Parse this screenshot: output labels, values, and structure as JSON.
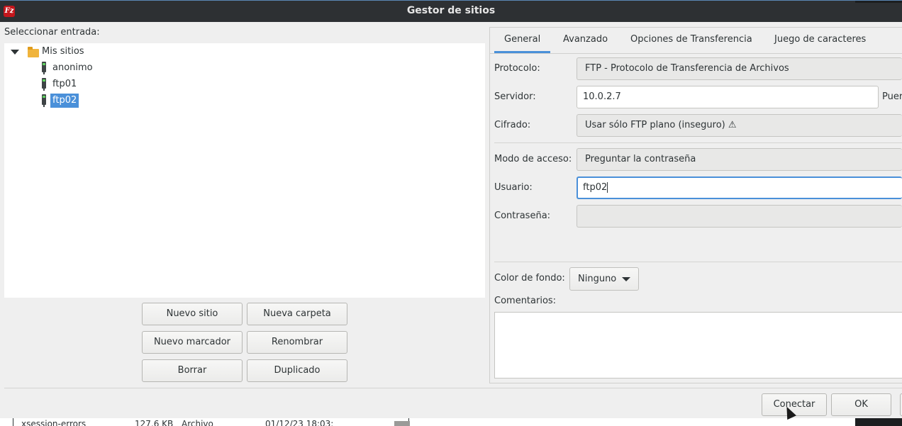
{
  "window": {
    "title": "Gestor de sitios",
    "app_icon_text": "Fz"
  },
  "left": {
    "select_label": "Seleccionar entrada:",
    "tree": {
      "root": "Mis sitios",
      "sites": [
        "anonimo",
        "ftp01",
        "ftp02"
      ],
      "selected": "ftp02"
    },
    "buttons": {
      "new_site": "Nuevo sitio",
      "new_folder": "Nueva carpeta",
      "new_bookmark": "Nuevo marcador",
      "rename": "Renombrar",
      "delete": "Borrar",
      "duplicate": "Duplicado"
    }
  },
  "tabs": [
    "General",
    "Avanzado",
    "Opciones de Transferencia",
    "Juego de caracteres"
  ],
  "active_tab": "General",
  "form": {
    "protocol_label": "Protocolo:",
    "protocol_value": "FTP - Protocolo de Transferencia de Archivos",
    "server_label": "Servidor:",
    "server_value": "10.0.2.7",
    "port_label_partial": "Puer",
    "encryption_label": "Cifrado:",
    "encryption_value": "Usar sólo FTP plano (inseguro) ⚠",
    "logon_label": "Modo de acceso:",
    "logon_value": "Preguntar la contraseña",
    "user_label": "Usuario:",
    "user_value": "ftp02",
    "password_label": "Contraseña:",
    "password_value": "",
    "bgcolor_label": "Color de fondo:",
    "bgcolor_value": "Ninguno",
    "comments_label": "Comentarios:",
    "comments_value": ""
  },
  "footer": {
    "connect": "Conectar",
    "ok": "OK"
  },
  "background_window": {
    "file_name": "xsession-errors",
    "file_size": "127,6 KB",
    "file_type": "Archivo",
    "file_date": "01/12/23 18:03:"
  },
  "colors": {
    "accent": "#4a90d9",
    "titlebar": "#2d3033"
  }
}
